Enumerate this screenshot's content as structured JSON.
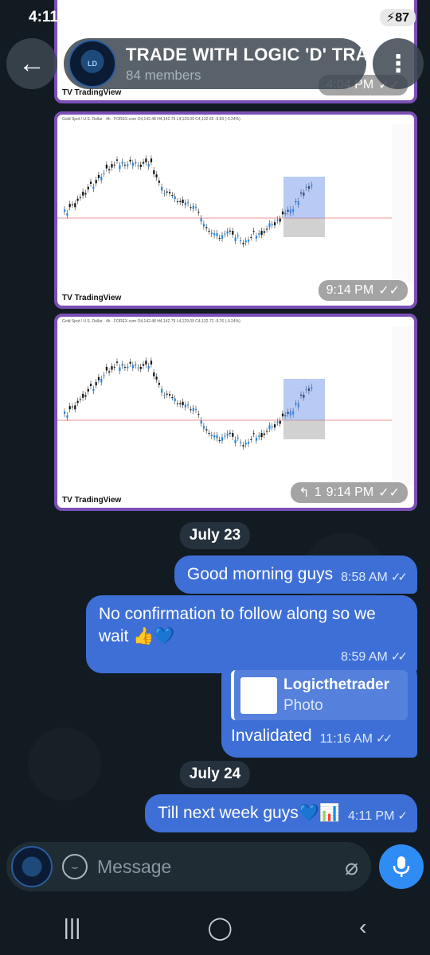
{
  "status": {
    "time": "4:11",
    "battery": "87"
  },
  "header": {
    "title": "TRADE WITH LOGIC 'D' TRA",
    "members": "84 members"
  },
  "messages": [
    {
      "type": "image",
      "time": "4:04 PM"
    },
    {
      "type": "image",
      "time": "9:14 PM",
      "caption": "TradingView",
      "chart_head": "Gold Spot / U.S. Dollar · 4h · FOREX.com  O4,142.48 H4,142.79 L4,129.09 C4,132.65 -9.83 (-0.24%)"
    },
    {
      "type": "image",
      "time": "9:14 PM",
      "replies": "1",
      "caption": "TradingView",
      "chart_head": "Gold Spot / U.S. Dollar · 4h · FOREX.com  O4,142.48 H4,142.79 L4,129.09 C4,132.72 -9.76 (-0.24%)"
    }
  ],
  "dates": {
    "d1": "July 23",
    "d2": "July 24"
  },
  "bubbles": {
    "b1": {
      "text": "Good morning guys",
      "time": "8:58 AM"
    },
    "b2": {
      "text": "No confirmation to follow along so we wait 👍💙",
      "time": "8:59 AM"
    },
    "b3": {
      "reply_name": "Logicthetrader",
      "reply_type": "Photo",
      "text": "Invalidated",
      "time": "11:16 AM"
    },
    "b4": {
      "text": "Till next week guys💙📊",
      "time": "4:11 PM"
    }
  },
  "composer": {
    "placeholder": "Message"
  },
  "colors": {
    "bubble": "#3e6fd6",
    "accent": "#2f8cf5",
    "border": "#7b4fb5"
  }
}
